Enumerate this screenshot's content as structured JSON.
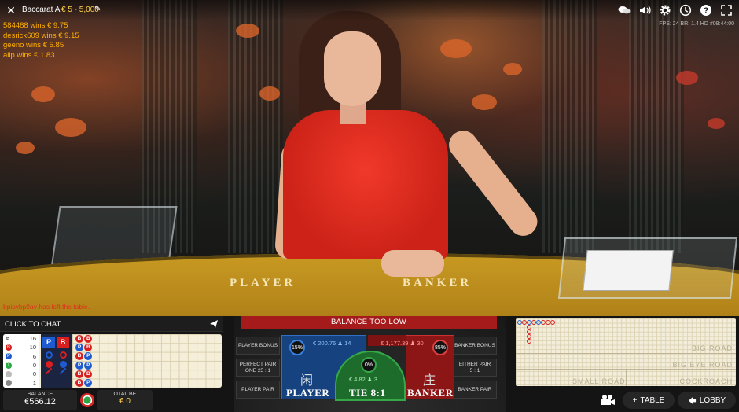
{
  "header": {
    "table_name": "Baccarat A",
    "limits": "€ 5 - 5,000"
  },
  "winners": [
    "584488 wins € 9.75",
    "desrick609 wins € 9.15",
    "geeno wins € 5.85",
    "alip wins € 1.83"
  ],
  "stats_line": "FPS: 24 BR: 1.4   HD   #09:44:00",
  "notification": "bpisvbp9av has left the table.",
  "scene": {
    "felt_player": "PLAYER",
    "felt_banker": "BANKER"
  },
  "top_icons": [
    "chat-icon",
    "volume-icon",
    "settings-icon",
    "history-icon",
    "help-icon",
    "fullscreen-icon"
  ],
  "chat": {
    "label": "CLICK TO CHAT"
  },
  "bead_stats": [
    {
      "symbol": "#",
      "value": "16"
    },
    {
      "symbol": "B",
      "value": "10"
    },
    {
      "symbol": "P",
      "value": "6"
    },
    {
      "symbol": "T",
      "value": "0"
    },
    {
      "symbol": "•",
      "value": "0"
    },
    {
      "symbol": "•",
      "value": "1"
    }
  ],
  "predictor": {
    "player": "P",
    "banker": "B"
  },
  "balance": {
    "label": "BALANCE",
    "value": "€566.12"
  },
  "total_bet": {
    "label": "TOTAL BET",
    "value": "€ 0"
  },
  "betting": {
    "banner": "BALANCE TOO LOW",
    "player_bonus": "PLAYER BONUS",
    "perfect_pair": "PERFECT PAIR",
    "perfect_pair_odds": "ONE 25 : 1",
    "player_pair": "PLAYER PAIR",
    "banker_bonus": "BANKER BONUS",
    "either_pair": "EITHER PAIR",
    "either_pair_odds": "5 : 1",
    "banker_pair": "BANKER PAIR",
    "player_pct": "15%",
    "player_amount": "€ 200.76 ♟ 14",
    "banker_amount": "€ 1,177.39 ♟ 30",
    "banker_pct": "85%",
    "tie_pct": "0%",
    "tie_amount": "€ 4.82 ♟ 3",
    "player_cn": "闲",
    "player_label": "PLAYER",
    "tie_label": "TIE 8:1",
    "banker_cn": "庄",
    "banker_label": "BANKER"
  },
  "roads": {
    "big_road": "BIG ROAD",
    "big_eye_road": "BIG EYE ROAD",
    "small_road": "SMALL ROAD",
    "cockroach": "COCKROACH"
  },
  "buttons": {
    "table": "TABLE",
    "lobby": "LOBBY"
  },
  "colors": {
    "player": "#1f5bd0",
    "banker": "#d81e1e",
    "tie": "#1d6c2c",
    "accent": "#ffcf4a"
  }
}
